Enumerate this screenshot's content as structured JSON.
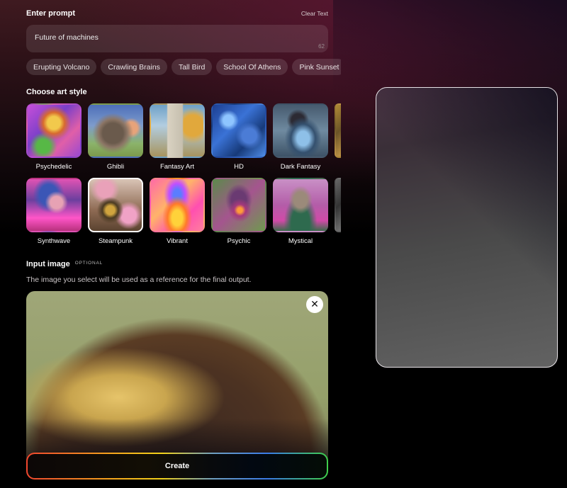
{
  "prompt": {
    "title": "Enter prompt",
    "clear_label": "Clear Text",
    "value": "Future of machines",
    "char_count": "62"
  },
  "suggestions": [
    "Erupting Volcano",
    "Crawling Brains",
    "Tall Bird",
    "School Of Athens",
    "Pink Sunset"
  ],
  "art_style": {
    "title": "Choose art style",
    "selected": "Steampunk",
    "row1": [
      "Psychedelic",
      "Ghibli",
      "Fantasy Art",
      "HD",
      "Dark Fantasy"
    ],
    "row2": [
      "Synthwave",
      "Steampunk",
      "Vibrant",
      "Psychic",
      "Mystical"
    ]
  },
  "input_image": {
    "title": "Input image",
    "optional_label": "OPTIONAL",
    "description": "The image you select will be used as a reference for the final output.",
    "close_glyph": "✕"
  },
  "create": {
    "label": "Create"
  },
  "colors": {
    "accent_gradient": [
      "#f0462e",
      "#f5a51d",
      "#f2d21a",
      "#3a7be8",
      "#3fd04a"
    ],
    "selected_border": "#ffffff"
  }
}
